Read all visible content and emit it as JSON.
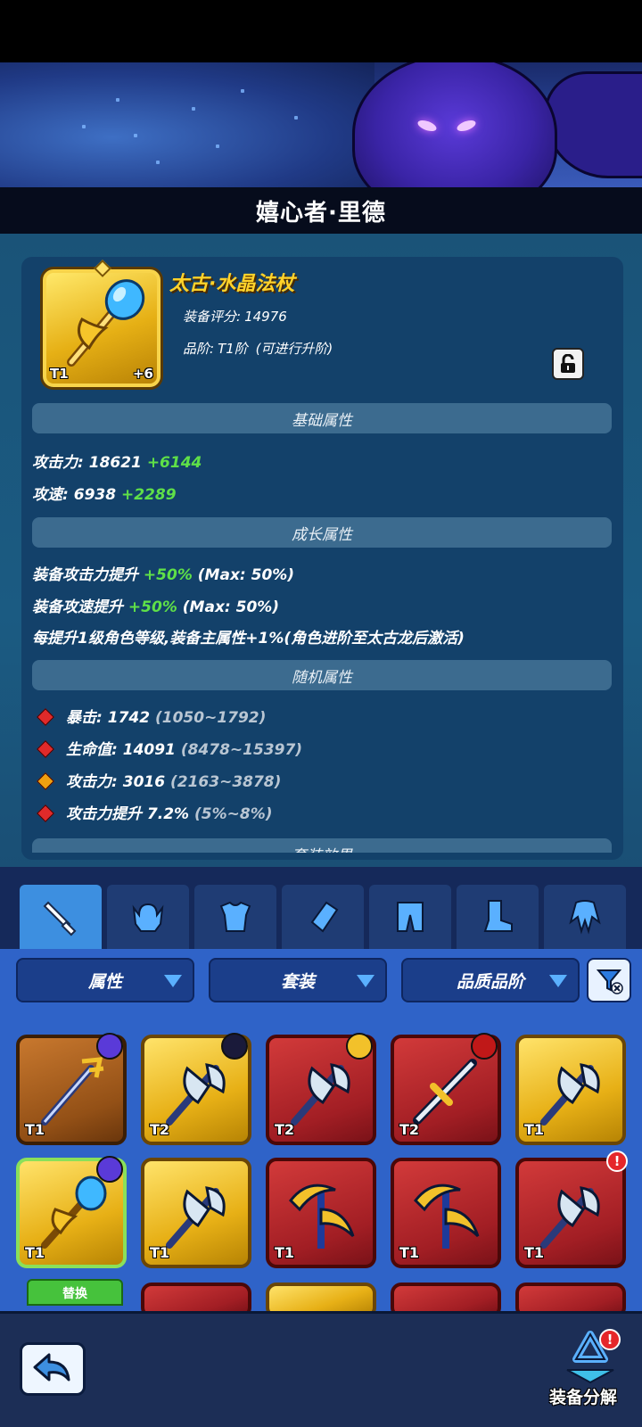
{
  "hero": {
    "name": "嬉心者·里德"
  },
  "item": {
    "name": "太古·水晶法杖",
    "score_label": "装备评分:",
    "score_value": "14976",
    "grade_label": "品阶:",
    "grade_value": "T1阶",
    "grade_note": "(可进行升阶)",
    "tier": "T1",
    "enhance": "+6",
    "lock_icon": "lock-icon"
  },
  "sections": {
    "base": "基础属性",
    "growth": "成长属性",
    "random": "随机属性",
    "set": "套装效果"
  },
  "base_stats": [
    {
      "label": "攻击力:",
      "value": "18621",
      "bonus": "+6144"
    },
    {
      "label": "攻速:",
      "value": "6938",
      "bonus": "+2289"
    }
  ],
  "growth_stats": [
    {
      "label": "装备攻击力提升",
      "value": "+50%",
      "max": "(Max: 50%)"
    },
    {
      "label": "装备攻速提升",
      "value": "+50%",
      "max": "(Max: 50%)"
    },
    {
      "text": "每提升1级角色等级,装备主属性+1%(角色进阶至太古龙后激活)"
    }
  ],
  "random_stats": [
    {
      "label": "暴击:",
      "value": "1742",
      "range": "(1050~1792)",
      "gem": "red"
    },
    {
      "label": "生命值:",
      "value": "14091",
      "range": "(8478~15397)",
      "gem": "red"
    },
    {
      "label": "攻击力:",
      "value": "3016",
      "range": "(2163~3878)",
      "gem": "gold"
    },
    {
      "label": "攻击力提升",
      "value": "7.2%",
      "range": "(5%~8%)",
      "gem": "red"
    }
  ],
  "tabs": [
    {
      "icon": "sword-icon",
      "active": true
    },
    {
      "icon": "helmet-icon",
      "active": false
    },
    {
      "icon": "armor-icon",
      "active": false
    },
    {
      "icon": "bracer-icon",
      "active": false
    },
    {
      "icon": "pants-icon",
      "active": false
    },
    {
      "icon": "boots-icon",
      "active": false
    },
    {
      "icon": "cape-icon",
      "active": false
    }
  ],
  "filters": {
    "attribute": "属性",
    "set": "套装",
    "quality": "品质品阶"
  },
  "inventory": [
    {
      "tier": "T1",
      "rarity": "brown",
      "weapon": "trident",
      "badge": "purple"
    },
    {
      "tier": "T2",
      "rarity": "gold",
      "weapon": "axe",
      "badge": "dark"
    },
    {
      "tier": "T2",
      "rarity": "red",
      "weapon": "axe",
      "badge": "yellow"
    },
    {
      "tier": "T2",
      "rarity": "red",
      "weapon": "sword",
      "badge": "crimson"
    },
    {
      "tier": "T1",
      "rarity": "gold",
      "weapon": "axe",
      "badge": ""
    },
    {
      "tier": "T1",
      "rarity": "gold",
      "weapon": "staff",
      "badge": "purple"
    },
    {
      "tier": "T1",
      "rarity": "gold",
      "weapon": "axe",
      "badge": ""
    },
    {
      "tier": "T1",
      "rarity": "red",
      "weapon": "scythe",
      "badge": ""
    },
    {
      "tier": "T1",
      "rarity": "red",
      "weapon": "scythe",
      "badge": ""
    },
    {
      "tier": "T1",
      "rarity": "red",
      "weapon": "axe",
      "badge": "alert"
    }
  ],
  "equip_button": "替换",
  "alert_mark": "!",
  "bottom": {
    "dismantle": "装备分解",
    "back_icon": "back-arrow-icon"
  },
  "colors": {
    "gold": "#ffd22a",
    "green": "#5fe048",
    "tab_active": "#3d8fe0",
    "panel": "#13416a"
  }
}
